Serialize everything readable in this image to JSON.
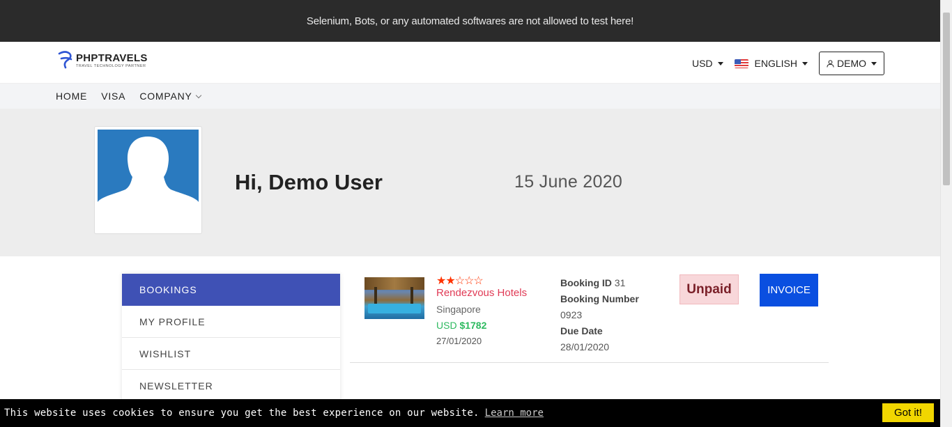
{
  "topbar": {
    "notice": "Selenium, Bots, or any automated softwares are not allowed to test here!"
  },
  "header": {
    "logo_title": "PHPTRAVELS",
    "logo_subtitle": "TRAVEL TECHNOLOGY PARTNER",
    "currency": "USD",
    "language": "ENGLISH",
    "account": "DEMO"
  },
  "nav": {
    "items": [
      "HOME",
      "VISA",
      "COMPANY"
    ]
  },
  "profile": {
    "greeting": "Hi, Demo User",
    "date": "15 June 2020"
  },
  "sidebar": {
    "items": [
      "BOOKINGS",
      "MY PROFILE",
      "WISHLIST",
      "NEWSLETTER"
    ]
  },
  "booking": {
    "rating": 2,
    "max_rating": 5,
    "hotel_name": "Rendezvous Hotels",
    "city": "Singapore",
    "currency": "USD",
    "price": "$1782",
    "booking_date": "27/01/2020",
    "booking_id_label": "Booking ID",
    "booking_id": "31",
    "booking_number_label": "Booking Number",
    "booking_number": "0923",
    "due_date_label": "Due Date",
    "due_date": "28/01/2020",
    "status": "Unpaid",
    "invoice_label": "INVOICE"
  },
  "cookie": {
    "message": "This website uses cookies to ensure you get the best experience on our website.",
    "link": "Learn more",
    "button": "Got it!"
  },
  "colors": {
    "accent": "#3f51b5",
    "invoice": "#0a4fe0",
    "hotel_name": "#e03a55",
    "price": "#2dba5f",
    "cookie_button": "#f1d600"
  }
}
